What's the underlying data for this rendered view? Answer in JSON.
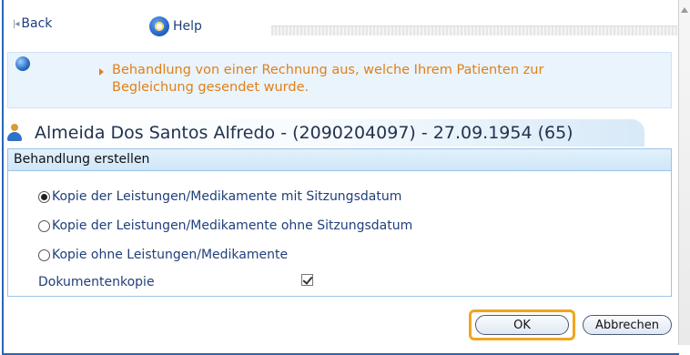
{
  "toolbar": {
    "back_label": "Back",
    "help_label": "Help"
  },
  "info": {
    "message_line1": "Behandlung von einer Rechnung aus, welche Ihrem Patienten zur",
    "message_line2": "Begleichung gesendet wurde."
  },
  "patient": {
    "header": "Almeida Dos Santos Alfredo - (2090204097) - 27.09.1954 (65)"
  },
  "section": {
    "title": "Behandlung erstellen",
    "options": [
      {
        "label": "Kopie der Leistungen/Medikamente mit Sitzungsdatum",
        "selected": true
      },
      {
        "label": "Kopie der Leistungen/Medikamente ohne Sitzungsdatum",
        "selected": false
      },
      {
        "label": "Kopie ohne Leistungen/Medikamente",
        "selected": false
      }
    ],
    "document_copy_label": "Dokumentenkopie",
    "document_copy_checked": true
  },
  "buttons": {
    "ok_label": "OK",
    "cancel_label": "Abbrechen"
  },
  "colors": {
    "accent_orange": "#e0801a",
    "highlight": "#f0a51e",
    "frame_blue": "#2a66b8",
    "link_blue": "#1f3f7a"
  }
}
